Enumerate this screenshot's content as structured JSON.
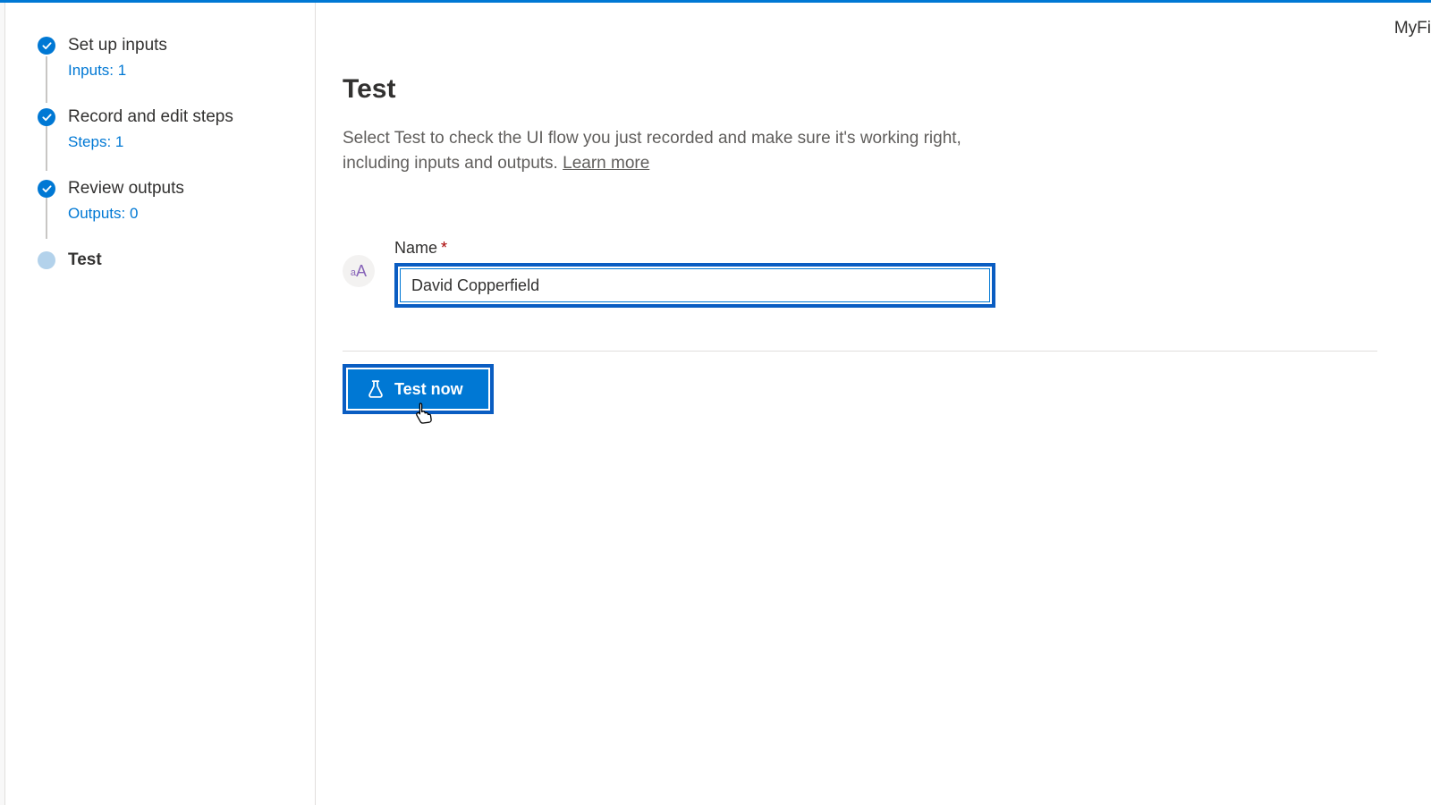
{
  "header": {
    "right_text": "MyFi"
  },
  "sidebar": {
    "steps": [
      {
        "title": "Set up inputs",
        "subtitle": "Inputs: 1",
        "done": true
      },
      {
        "title": "Record and edit steps",
        "subtitle": "Steps: 1",
        "done": true
      },
      {
        "title": "Review outputs",
        "subtitle": "Outputs: 0",
        "done": true
      },
      {
        "title": "Test",
        "subtitle": "",
        "done": false,
        "current": true
      }
    ]
  },
  "main": {
    "title": "Test",
    "description": "Select Test to check the UI flow you just recorded and make sure it's working right, including inputs and outputs. ",
    "learn_more": "Learn more",
    "field": {
      "label": "Name",
      "required_marker": "*",
      "value": "David Copperfield",
      "type_badge": "aA"
    },
    "action_button": "Test now"
  }
}
